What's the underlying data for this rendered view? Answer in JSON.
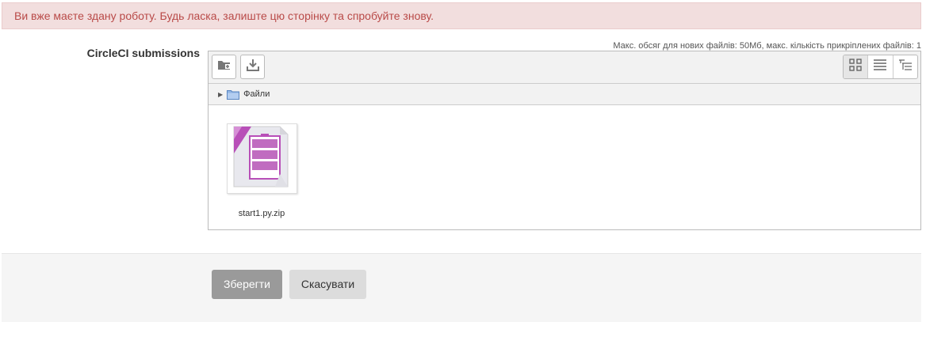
{
  "alert": {
    "message": "Ви вже маєте здану роботу. Будь ласка, залиште цю сторінку та спробуйте знову."
  },
  "form": {
    "field_label": "CircleCI submissions",
    "limits_text": "Макс. обсяг для нових файлів: 50Мб, макс. кількість прикріплених файлів: 1"
  },
  "filemanager": {
    "toolbar": {
      "icons": [
        "create-folder-icon",
        "download-icon"
      ],
      "views": [
        "icons-view-icon",
        "list-view-icon",
        "tree-view-icon"
      ],
      "active_view": "icons-view-icon"
    },
    "path": {
      "label": "Файли"
    },
    "files": [
      {
        "name": "start1.py.zip",
        "icon": "archive-file-icon"
      }
    ]
  },
  "buttons": {
    "save_label": "Зберегти",
    "cancel_label": "Скасувати"
  },
  "colors": {
    "alert_bg": "#f2dede",
    "alert_text": "#b94a48",
    "archive_purple": "#b84fb8",
    "save_button": "#9a9a9a"
  }
}
